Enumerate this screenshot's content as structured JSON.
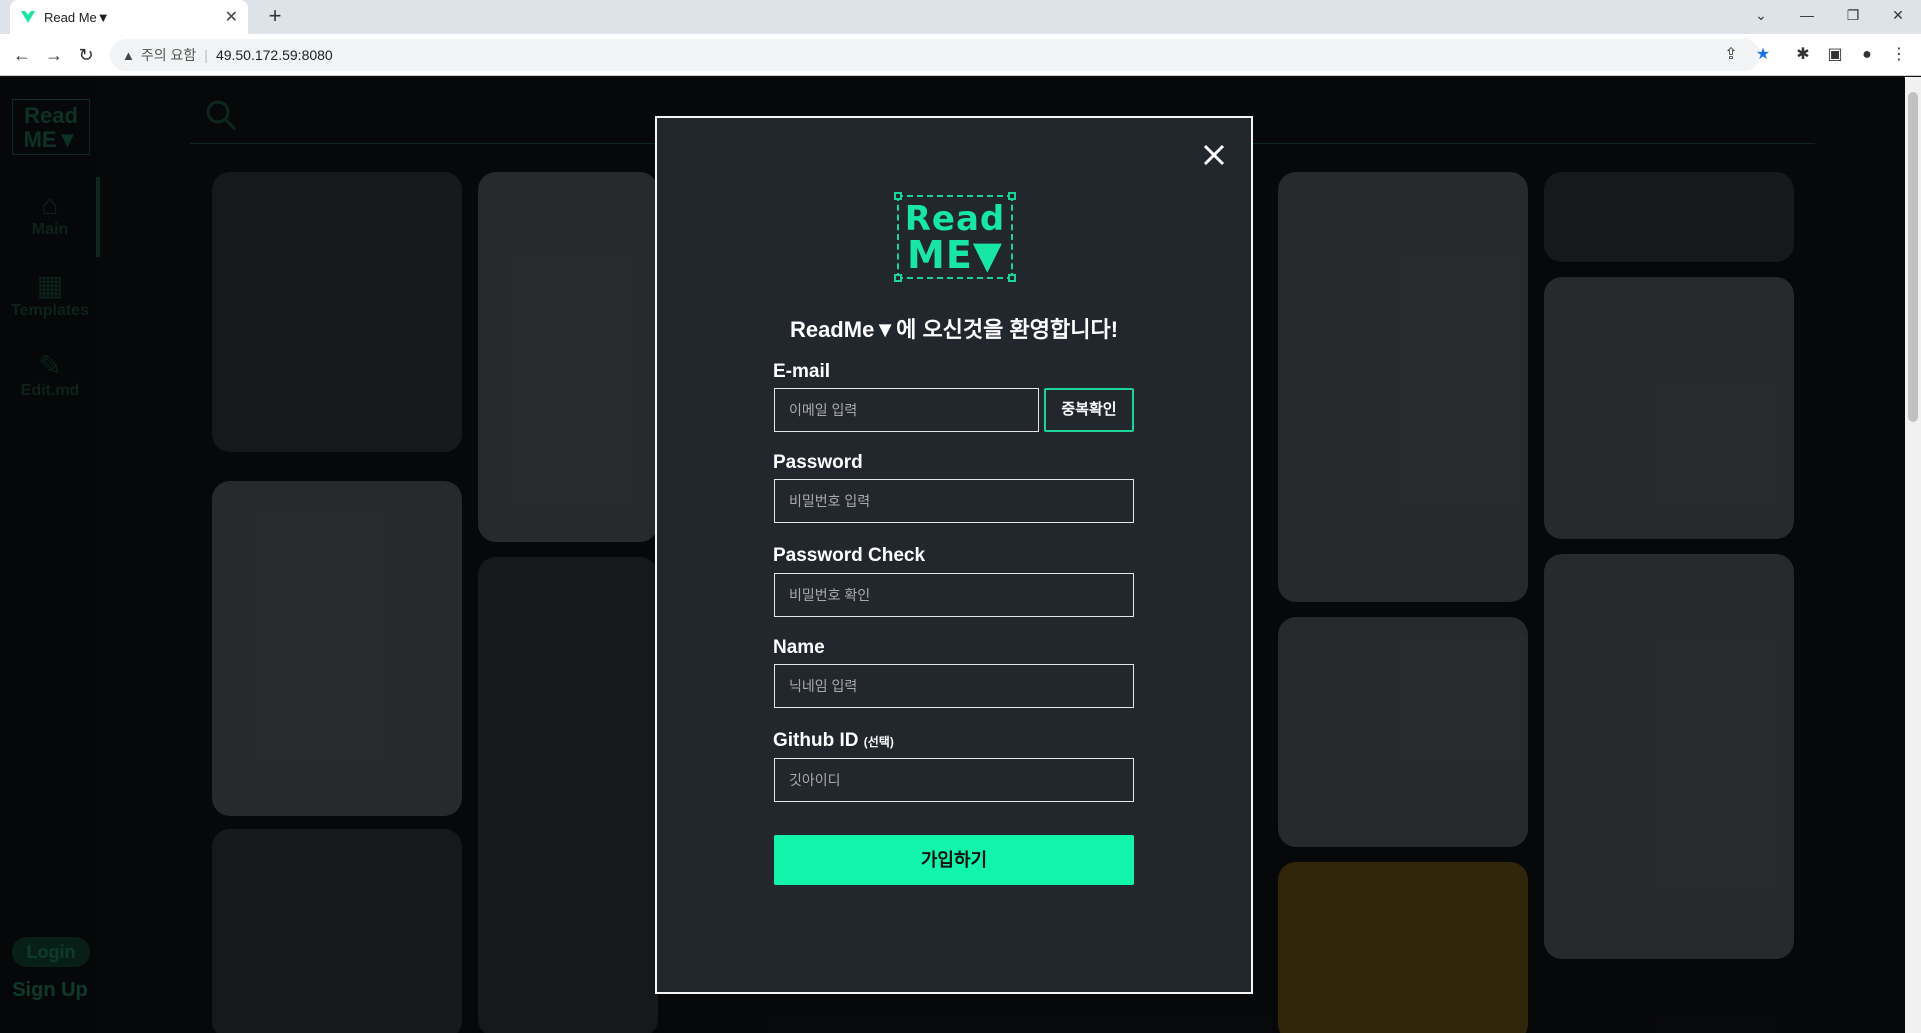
{
  "browser": {
    "tab_title": "Read Me▼",
    "new_tab_icon": "+",
    "security_label": "주의 요함",
    "url": "49.50.172.59:8080"
  },
  "sidebar": {
    "logo_line1": "Read",
    "logo_line2": "ME▼",
    "items": [
      {
        "label": "Main",
        "icon": "home-icon"
      },
      {
        "label": "Templates",
        "icon": "templates-icon"
      },
      {
        "label": "Edit.md",
        "icon": "pencil-icon"
      }
    ],
    "login_label": "Login",
    "signup_label": "Sign Up"
  },
  "modal": {
    "logo_line1": "Read",
    "logo_line2": "ME▼",
    "welcome": "ReadMe▼에 오신것을 환영합니다!",
    "email_label": "E-mail",
    "email_placeholder": "이메일 입력",
    "dup_check_label": "중복확인",
    "password_label": "Password",
    "password_placeholder": "비밀번호 입력",
    "password_check_label": "Password Check",
    "password_check_placeholder": "비밀번호 확인",
    "name_label": "Name",
    "name_placeholder": "닉네임 입력",
    "github_label": "Github ID",
    "github_optional": "(선택)",
    "github_placeholder": "깃아이디",
    "submit_label": "가입하기"
  },
  "colors": {
    "accent": "#11f5ab",
    "modal_bg": "#22272e"
  }
}
